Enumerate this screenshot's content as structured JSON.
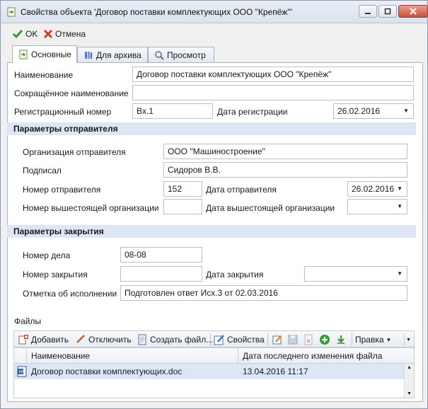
{
  "window": {
    "title": "Свойства объекта 'Договор поставки комплектующих ООО \"Крепёж\"'"
  },
  "toolbar": {
    "ok_label": "OK",
    "cancel_label": "Отмена"
  },
  "tabs": [
    {
      "label": "Основные",
      "icon": "doc-arrow-icon",
      "active": true
    },
    {
      "label": "Для архива",
      "icon": "archive-books-icon",
      "active": false
    },
    {
      "label": "Просмотр",
      "icon": "magnifier-icon",
      "active": false
    }
  ],
  "main": {
    "name_label": "Наименование",
    "name_value": "Договор поставки комплектующих ООО \"Крепёж\"",
    "short_name_label": "Сокращённое наименование",
    "short_name_value": "",
    "reg_number_label": "Регистрационный номер",
    "reg_number_value": "Вх.1",
    "reg_date_label": "Дата регистрации",
    "reg_date_value": "26.02.2016"
  },
  "sender": {
    "section_title": "Параметры отправителя",
    "org_label": "Организация отправителя",
    "org_value": "ООО \"Машиностроение\"",
    "signed_label": "Подписал",
    "signed_value": "Сидоров В.В.",
    "number_label": "Номер отправителя",
    "number_value": "152",
    "date_label": "Дата отправителя",
    "date_value": "26.02.2016",
    "parent_number_label": "Номер вышестоящей организации",
    "parent_number_value": "",
    "parent_date_label": "Дата вышестоящей организации",
    "parent_date_value": ""
  },
  "closing": {
    "section_title": "Параметры закрытия",
    "case_label": "Номер дела",
    "case_value": "08-08",
    "close_number_label": "Номер закрытия",
    "close_number_value": "",
    "close_date_label": "Дата закрытия",
    "close_date_value": "",
    "execution_label": "Отметка об исполнении",
    "execution_value": "Подготовлен ответ Исх.3 от 02.03.2016"
  },
  "files": {
    "section_label": "Файлы",
    "toolbar": {
      "add_label": "Добавить",
      "detach_label": "Отключить",
      "create_label": "Создать файл...",
      "props_label": "Свойства",
      "edit_label": "Правка"
    },
    "columns": [
      "Наименование",
      "Дата последнего изменения файла"
    ],
    "rows": [
      {
        "name": "Договор поставки комплектующих.doc",
        "modified": "13.04.2016 11:17"
      }
    ]
  },
  "colors": {
    "section_bg": "#dce6f4",
    "selection_bg": "#dbe7f7",
    "ok_green": "#2e9d2e",
    "cancel_red": "#d23b2b"
  }
}
